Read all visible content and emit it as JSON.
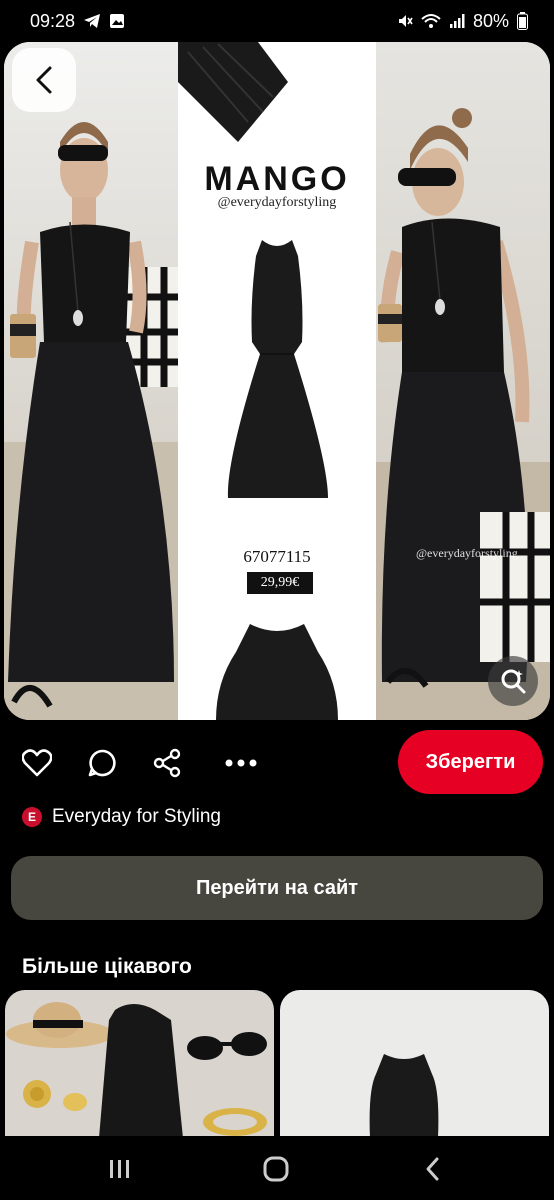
{
  "status_bar": {
    "time": "09:28",
    "battery": "80%",
    "icons": [
      "telegram-icon",
      "gallery-icon",
      "mute-icon",
      "wifi-icon",
      "signal-icon",
      "battery-icon"
    ]
  },
  "pin": {
    "brand": "MANGO",
    "handle": "@everydayforstyling",
    "product_code": "67077115",
    "price": "29,99€",
    "watermark": "@everydayforstyling",
    "colors": {
      "dress": "#151515",
      "skirt": "#1b1b1d"
    }
  },
  "actions": {
    "icons": [
      "heart-icon",
      "comment-icon",
      "share-icon",
      "more-icon"
    ],
    "save_label": "Зберегти"
  },
  "creator": {
    "badge": "E",
    "name": "Everyday for Styling"
  },
  "visit_site_label": "Перейти на сайт",
  "more_section": {
    "title": "Більше цікавого"
  },
  "nav": {
    "icons": [
      "recent-apps-icon",
      "home-icon",
      "back-icon"
    ]
  },
  "theme": {
    "accent": "#e60023",
    "secondary_button": "#47473f",
    "background": "#000000"
  }
}
